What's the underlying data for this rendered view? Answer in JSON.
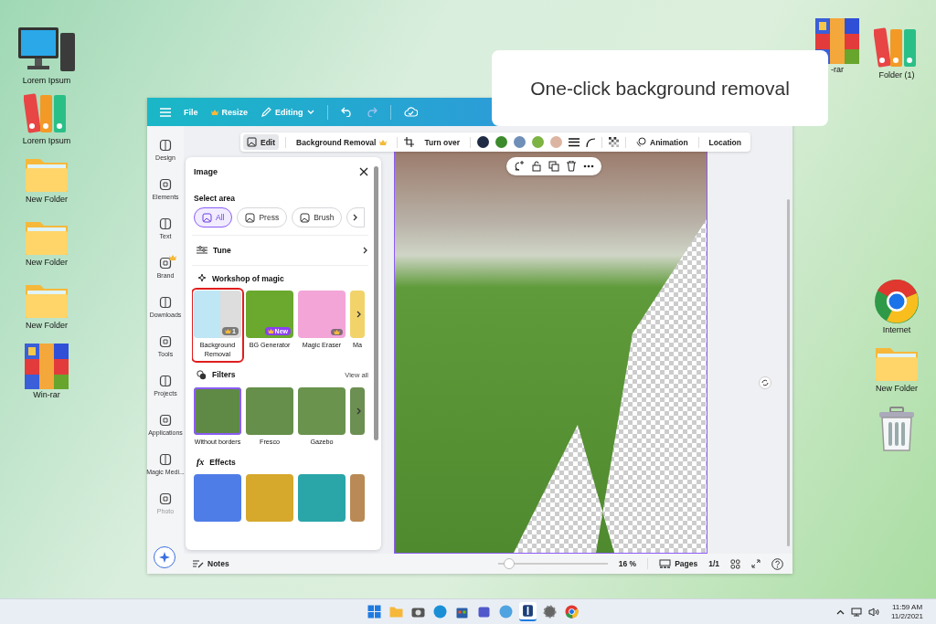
{
  "desktop": {
    "left_icons": [
      {
        "kind": "monitor",
        "label": "Lorem Ipsum"
      },
      {
        "kind": "binders",
        "label": "Lorem Ipsum"
      },
      {
        "kind": "folder",
        "label": "New Folder"
      },
      {
        "kind": "folder",
        "label": "New Folder"
      },
      {
        "kind": "folder",
        "label": "New Folder"
      },
      {
        "kind": "winrar",
        "label": "Win-rar"
      }
    ],
    "right_icons": [
      {
        "kind": "winrar",
        "label": "-rar"
      },
      {
        "kind": "binders",
        "label": "Folder (1)"
      },
      {
        "kind": "chrome",
        "label": "Internet"
      },
      {
        "kind": "folder",
        "label": "New Folder"
      },
      {
        "kind": "trash"
      }
    ]
  },
  "callout": {
    "text": "One-click background removal"
  },
  "topbar": {
    "file": "File",
    "resize": "Resize",
    "editing": "Editing"
  },
  "rail": [
    {
      "label": "Design",
      "crown": false
    },
    {
      "label": "Elements",
      "crown": false
    },
    {
      "label": "Text",
      "crown": false
    },
    {
      "label": "Brand",
      "crown": true
    },
    {
      "label": "Downloads",
      "crown": false
    },
    {
      "label": "Tools",
      "crown": false
    },
    {
      "label": "Projects",
      "crown": false
    },
    {
      "label": "Applications",
      "crown": false
    },
    {
      "label": "Magic Medi...",
      "crown": false
    },
    {
      "label": "Photo",
      "crown": false
    }
  ],
  "toolbar": {
    "edit": {
      "label": "Edit",
      "selected": true
    },
    "bg_removal": "Background Removal",
    "turn_over": "Turn over",
    "swatches": [
      {
        "color": "#1f2a44"
      },
      {
        "color": "#3b8a2c"
      },
      {
        "color": "#6f8fb8"
      },
      {
        "color": "#7cb342"
      },
      {
        "color": "#dcb5a2"
      }
    ],
    "animation": "Animation",
    "location": "Location"
  },
  "panel": {
    "title": "Image",
    "select_area": "Select area",
    "chips": [
      {
        "label": "All",
        "selected": true
      },
      {
        "label": "Press",
        "selected": false
      },
      {
        "label": "Brush",
        "selected": false
      }
    ],
    "tune": "Tune",
    "workshop": "Workshop of magic",
    "magic_tiles": [
      {
        "label": "Background Removal",
        "highlighted": true,
        "badge": {
          "crown": true,
          "text": "1"
        }
      },
      {
        "label": "BG Generator",
        "highlighted": false,
        "badge": {
          "crown": true,
          "text": "New"
        }
      },
      {
        "label": "Magic Eraser",
        "highlighted": false,
        "badge": {
          "crown": true
        }
      },
      {
        "label": "Ma",
        "highlighted": false
      }
    ],
    "filters": "Filters",
    "view_all": "View all",
    "filter_tiles": [
      {
        "label": "Without borders",
        "selected": true
      },
      {
        "label": "Fresco",
        "selected": false
      },
      {
        "label": "Gazebo",
        "selected": false
      },
      {
        "selected": false
      }
    ],
    "effects_icon": "fx",
    "effects": "Effects"
  },
  "bottom": {
    "notes": "Notes",
    "zoom": {
      "level": 0.1
    },
    "zoom_text": "16 %",
    "pages": "Pages",
    "page_count": "1/1"
  },
  "taskbar": {
    "time": "11:59 AM",
    "date": "11/2/2021"
  }
}
